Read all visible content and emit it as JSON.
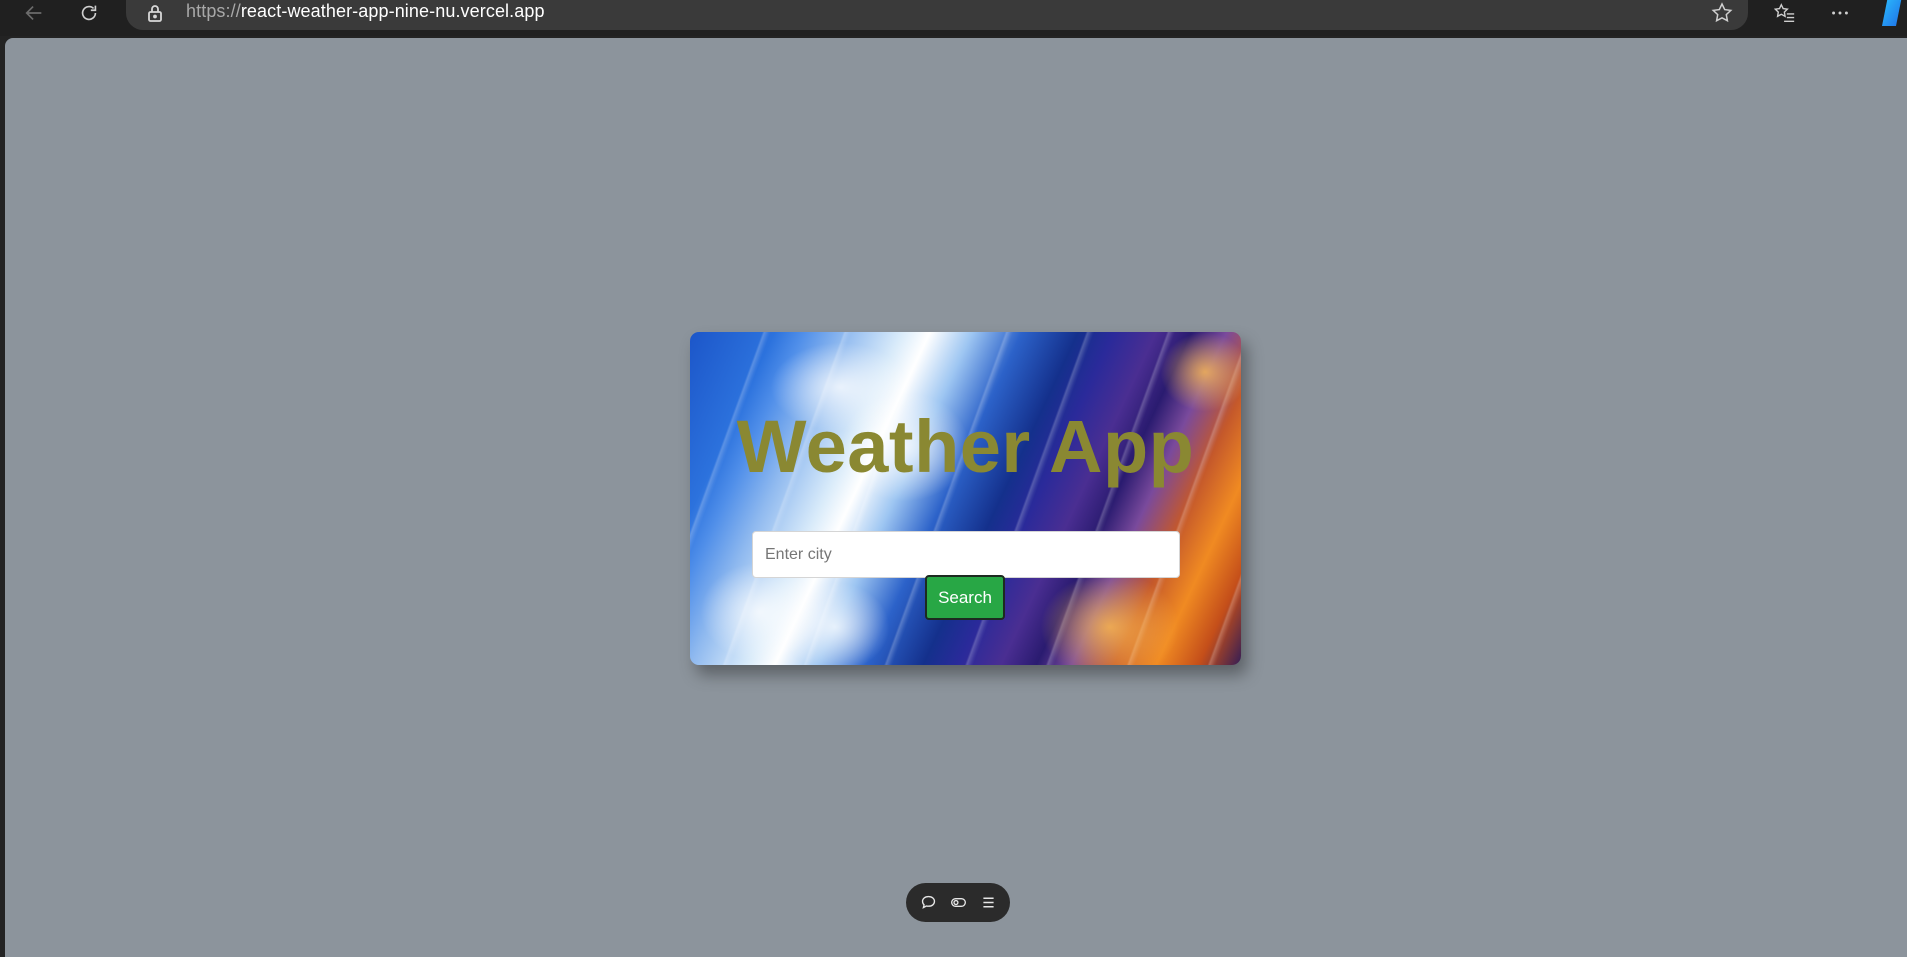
{
  "browser": {
    "url_scheme": "https://",
    "url_host": "react-weather-app-nine-nu.vercel.app",
    "icons": [
      "back-icon",
      "reload-icon",
      "lock-icon",
      "star-icon",
      "favorites-icon",
      "more-icon",
      "copilot-icon"
    ]
  },
  "app": {
    "title": "Weather App",
    "search": {
      "placeholder": "Enter city",
      "value": "",
      "button_label": "Search"
    },
    "colors": {
      "title": "#8a8832",
      "button": "#28a745",
      "page_background": "#8c949c"
    }
  },
  "floating_toolbar": {
    "icons": [
      "comment-icon",
      "toggle-icon",
      "menu-icon"
    ]
  }
}
